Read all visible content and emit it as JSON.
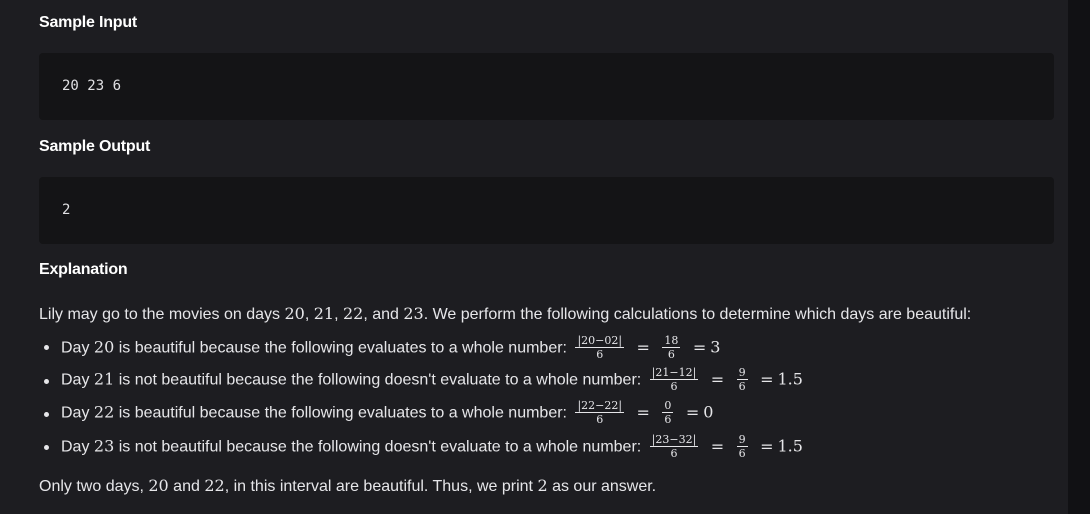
{
  "sample_input": {
    "heading": "Sample Input",
    "value": "20 23 6"
  },
  "sample_output": {
    "heading": "Sample Output",
    "value": "2"
  },
  "explanation": {
    "heading": "Explanation",
    "intro": {
      "pre": "Lily may go to the movies on days ",
      "d1": "20",
      "c1": ", ",
      "d2": "21",
      "c2": ", ",
      "d3": "22",
      "c3": ", and ",
      "d4": "23",
      "post": ". We perform the following calculations to determine which days are beautiful:"
    },
    "bullets": [
      {
        "pre": "Day ",
        "day": "20",
        "text": " is beautiful because the following evaluates to a whole number: ",
        "f1_num": "|20−02|",
        "f1_den": "6",
        "f2_num": "18",
        "f2_den": "6",
        "result": "3"
      },
      {
        "pre": "Day ",
        "day": "21",
        "text": " is not beautiful because the following doesn't evaluate to a whole number: ",
        "f1_num": "|21−12|",
        "f1_den": "6",
        "f2_num": "9",
        "f2_den": "6",
        "result": "1.5"
      },
      {
        "pre": "Day ",
        "day": "22",
        "text": " is beautiful because the following evaluates to a whole number: ",
        "f1_num": "|22−22|",
        "f1_den": "6",
        "f2_num": "0",
        "f2_den": "6",
        "result": "0"
      },
      {
        "pre": "Day ",
        "day": "23",
        "text": " is not beautiful because the following doesn't evaluate to a whole number: ",
        "f1_num": "|23−32|",
        "f1_den": "6",
        "f2_num": "9",
        "f2_den": "6",
        "result": "1.5"
      }
    ],
    "conclusion": {
      "pre": "Only two days, ",
      "d1": "20",
      "mid": " and ",
      "d2": "22",
      "mid2": ", in this interval are beautiful. Thus, we print ",
      "n": "2",
      "post": " as our answer."
    },
    "equals": "="
  },
  "colors": {
    "panel": "#1d1d21",
    "code_bg": "#141416",
    "text": "#e6e6e9",
    "page_bg": "#111114"
  }
}
